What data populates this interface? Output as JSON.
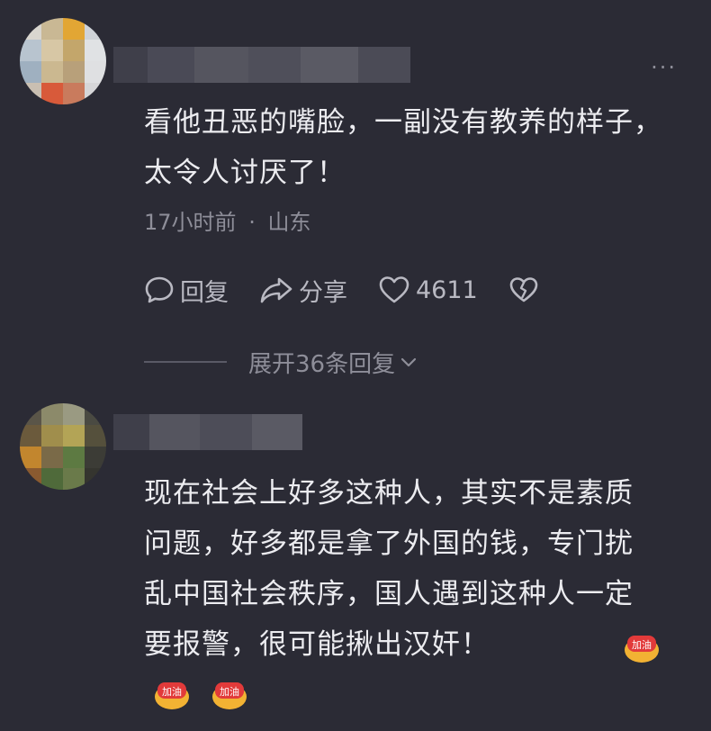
{
  "comments": [
    {
      "text": "看他丑恶的嘴脸，一副没有教养的样子，太令人讨厌了！",
      "time": "17小时前",
      "separator": "·",
      "location": "山东",
      "reply_label": "回复",
      "share_label": "分享",
      "likes": "4611",
      "expand_label": "展开36条回复"
    },
    {
      "text": "现在社会上好多这种人，其实不是素质问题，好多都是拿了外国的钱，专门扰乱中国社会秩序，国人遇到这种人一定要报警，很可能揪出汉奸！",
      "emoji_count": 3,
      "emoji_name": "jiayou-emoji"
    }
  ],
  "colors": {
    "background": "#2b2b35",
    "text": "#ececf0",
    "meta": "#8e8e99",
    "action": "#b9b9c2"
  },
  "icons": [
    "comment-bubble-icon",
    "share-arrow-icon",
    "heart-icon",
    "broken-heart-icon",
    "more-dots-icon",
    "chevron-down-icon"
  ]
}
